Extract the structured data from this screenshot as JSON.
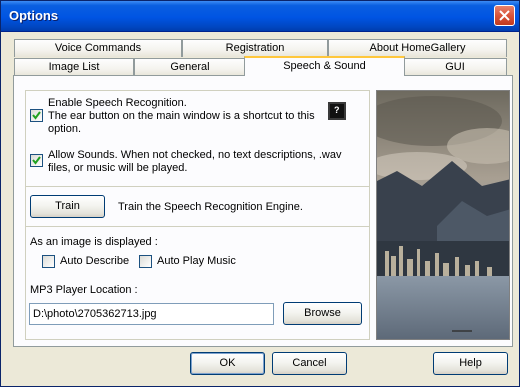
{
  "window": {
    "title": "Options"
  },
  "tabs": {
    "row_back": [
      "Voice Commands",
      "Registration",
      "About HomeGallery"
    ],
    "row_front": [
      "Image List",
      "General",
      "Speech & Sound",
      "GUI"
    ]
  },
  "speech": {
    "enable_label": "Enable Speech Recognition.",
    "enable_desc_1": "The ear button on the main window is a shortcut to this",
    "enable_desc_2": "option.",
    "enable_checked": true,
    "help_glyph": "?",
    "sounds_line_1": "Allow Sounds.  When not checked, no text descriptions, .wav",
    "sounds_line_2": "files, or music will be played.",
    "sounds_checked": true,
    "train_button": "Train",
    "train_desc": "Train the Speech Recognition Engine.",
    "image_displayed_label": "As an image is displayed :",
    "auto_describe_label": "Auto Describe",
    "auto_describe_checked": false,
    "auto_play_label": "Auto Play Music",
    "auto_play_checked": false,
    "mp3_label": "MP3 Player Location :",
    "mp3_path": "D:\\photo\\2705362713.jpg",
    "browse_button": "Browse"
  },
  "footer": {
    "ok": "OK",
    "cancel": "Cancel",
    "help": "Help"
  },
  "icons": {
    "close": "close-icon",
    "check": "check-icon",
    "help": "help-icon"
  },
  "colors": {
    "titlebar": "#0054e3",
    "dialog_bg": "#ece9d8",
    "tab_highlight": "#ffc73c",
    "close_button": "#d9553b"
  }
}
